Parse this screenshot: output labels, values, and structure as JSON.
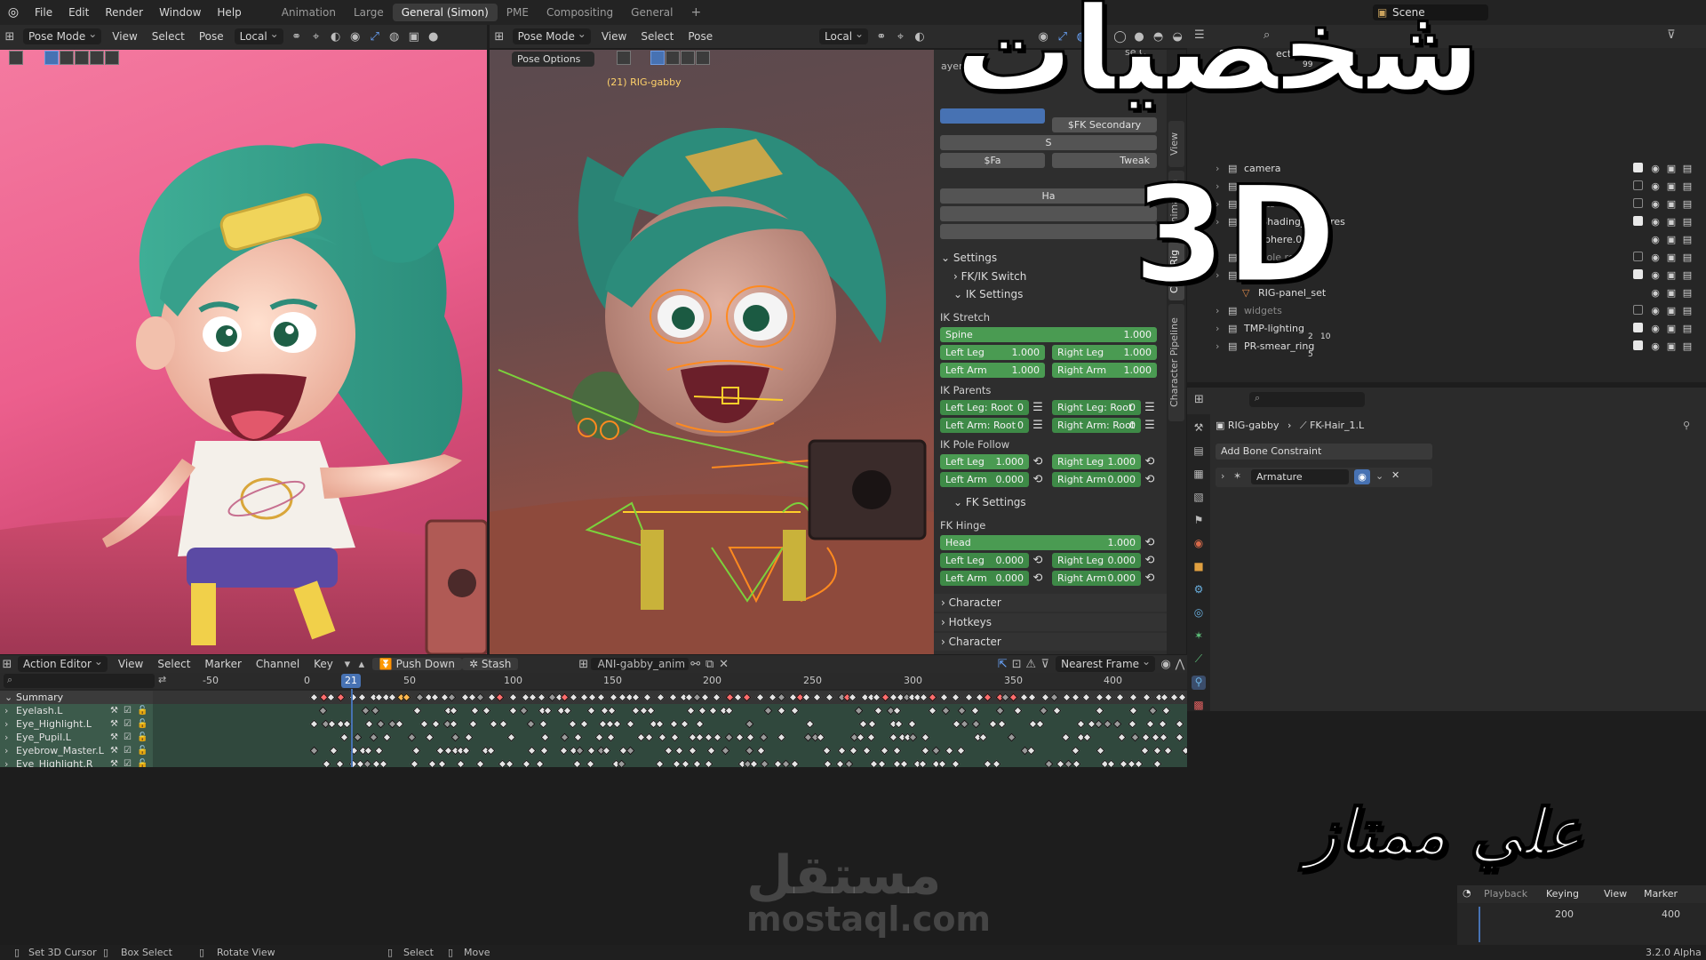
{
  "topbar": {
    "menus": [
      "File",
      "Edit",
      "Render",
      "Window",
      "Help"
    ],
    "workspaces": [
      "Animation",
      "Large",
      "General (Simon)",
      "PME",
      "Compositing",
      "General"
    ],
    "active_workspace": "General (Simon)",
    "scene": "Scene"
  },
  "left_view": {
    "mode": "Pose Mode",
    "menus": [
      "View",
      "Select",
      "Pose"
    ],
    "orientation": "Local",
    "pose_options": "Pose Options"
  },
  "right_view": {
    "mode": "Pose Mode",
    "menus": [
      "View",
      "Select",
      "Pose"
    ],
    "orientation": "Local",
    "object_label": "(21) RIG-gabby"
  },
  "npanel": {
    "partial": {
      "layers": "ayers",
      "fk_secondary": "$FK Secondary",
      "sh": "S",
      "fa": "$Fa",
      "tweak": "Tweak",
      "ha": "Ha",
      "se": "se C"
    },
    "settings": "Settings",
    "fkik_switch": "FK/IK Switch",
    "ik_settings": "IK Settings",
    "ik_stretch": "IK Stretch",
    "spine": {
      "label": "Spine",
      "value": "1.000"
    },
    "ik_stretch_rows": [
      {
        "l": "Left Leg",
        "lv": "1.000",
        "r": "Right Leg",
        "rv": "1.000"
      },
      {
        "l": "Left Arm",
        "lv": "1.000",
        "r": "Right Arm",
        "rv": "1.000"
      }
    ],
    "ik_parents": "IK Parents",
    "ik_parent_rows": [
      {
        "l": "Left Leg: Root",
        "lv": "0",
        "r": "Right Leg: Root",
        "rv": "0"
      },
      {
        "l": "Left Arm: Root",
        "lv": "0",
        "r": "Right Arm: Root",
        "rv": "0"
      }
    ],
    "ik_pole_follow": "IK Pole Follow",
    "ik_pole_rows": [
      {
        "l": "Left Leg",
        "lv": "1.000",
        "r": "Right Leg",
        "rv": "1.000"
      },
      {
        "l": "Left Arm",
        "lv": "0.000",
        "r": "Right Arm",
        "rv": "0.000"
      }
    ],
    "fk_settings": "FK Settings",
    "fk_hinge": "FK Hinge",
    "head": {
      "label": "Head",
      "value": "1.000"
    },
    "fk_hinge_rows": [
      {
        "l": "Left Leg",
        "lv": "0.000",
        "r": "Right Leg",
        "rv": "0.000"
      },
      {
        "l": "Left Arm",
        "lv": "0.000",
        "r": "Right Arm",
        "rv": "0.000"
      }
    ],
    "character": "Character",
    "hotkeys": "Hotkeys",
    "character2": "Character"
  },
  "side_tabs": [
    "View",
    "Animation",
    "CloudRig",
    "Character Pipeline"
  ],
  "outliner": {
    "partial_scene": "Scene",
    "partial_ection": "ection",
    "items": [
      {
        "name": "camera",
        "indent": 1,
        "checked": true
      },
      {
        "name": "trash",
        "indent": 1,
        "checked": false
      },
      {
        "name": "assets",
        "indent": 1,
        "checked": false
      },
      {
        "name": "SH-Shading_Spheres",
        "indent": 1,
        "checked": true
      },
      {
        "name": "Sphere.025",
        "indent": 2,
        "checked": null
      },
      {
        "name": "console ref",
        "indent": 1,
        "checked": false
      },
      {
        "name": "rig",
        "indent": 1,
        "checked": true
      },
      {
        "name": "RIG-panel_set",
        "indent": 2,
        "checked": null
      },
      {
        "name": "widgets",
        "indent": 1,
        "checked": false
      },
      {
        "name": "TMP-lighting",
        "indent": 1,
        "checked": true
      },
      {
        "name": "PR-smear_ring",
        "indent": 1,
        "checked": true
      }
    ],
    "sub_counts": {
      "tmp_a": "2",
      "tmp_b": "10",
      "smear": "5",
      "top": "99"
    }
  },
  "properties": {
    "breadcrumb_object": "RIG-gabby",
    "breadcrumb_bone": "FK-Hair_1.L",
    "add_constraint": "Add Bone Constraint",
    "constraint_name": "Armature"
  },
  "action_editor": {
    "editor": "Action Editor",
    "menus": [
      "View",
      "Select",
      "Marker",
      "Channel",
      "Key"
    ],
    "push_down": "Push Down",
    "stash": "Stash",
    "action_name": "ANI-gabby_anim",
    "snap": "Nearest Frame",
    "current_frame": "21",
    "ticks": [
      "-50",
      "0",
      "50",
      "100",
      "150",
      "200",
      "250",
      "300",
      "350",
      "400"
    ],
    "channels": [
      "Summary",
      "Eyelash.L",
      "Eye_Highlight.L",
      "Eye_Pupil.L",
      "Eyebrow_Master.L",
      "Eye_Highlight.R"
    ]
  },
  "timeline": {
    "menus": [
      "Playback",
      "Keying",
      "View",
      "Marker"
    ],
    "ticks": [
      "200",
      "400"
    ]
  },
  "status": {
    "items": [
      "Set 3D Cursor",
      "Box Select",
      "Rotate View",
      "Select",
      "Move"
    ],
    "version": "3.2.0 Alpha"
  },
  "overlay": {
    "title_arabic": "شخصيات",
    "title_3d": "3D",
    "signature": "علي ممتاز",
    "watermark_ar": "مستقل",
    "watermark_url": "mostaql.com"
  },
  "colors": {
    "accent_blue": "#4772b3",
    "slider_green": "#4a9b52",
    "key_selected": "#ffb94f",
    "playhead": "#4772b3"
  }
}
